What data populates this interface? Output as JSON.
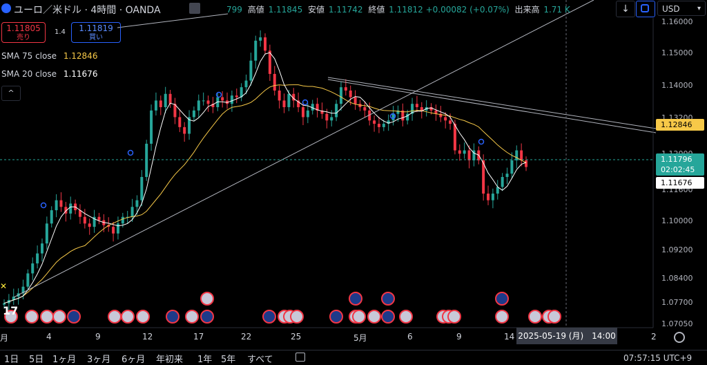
{
  "header": {
    "symbol_title": "ユーロ／米ドル · 4時間 · OANDA",
    "ohlc_open_partial": "799",
    "high_label": "高値",
    "high_value": "1.11845",
    "low_label": "安値",
    "low_value": "1.11742",
    "close_label": "終値",
    "close_value": "1.11812",
    "change": "+0.00082 (+0.07%)",
    "volume_label": "出来高",
    "volume_value": "1.71 K",
    "down_arrow": "↓",
    "currency": "USD"
  },
  "trade": {
    "sell_price": "1.11805",
    "sell_label": "売り",
    "spread": "1.4",
    "buy_price": "1.11819",
    "buy_label": "買い"
  },
  "indicators": [
    {
      "label": "SMA 75 close",
      "value": "1.12846"
    },
    {
      "label": "SMA 20 close",
      "value": "1.11676"
    }
  ],
  "price_axis": {
    "labels": [
      "1.16000",
      "1.15000",
      "1.14000",
      "1.13200",
      "1.12000",
      "1.11600",
      "1.10000",
      "1.09200",
      "1.08400",
      "1.07700",
      "1.07050"
    ],
    "tag_sma75": "1.12846",
    "tag_last": "1.11796",
    "tag_countdown": "02:02:45",
    "tag_sma20": "1.11676"
  },
  "time_axis": {
    "labels": [
      "月",
      "4",
      "9",
      "12",
      "17",
      "22",
      "25",
      "5月",
      "6",
      "9",
      "14",
      "2"
    ],
    "crosshair": "2025-05-19 (月)　14:00"
  },
  "bottom_bar": {
    "ranges": [
      "1日",
      "5日",
      "1ヶ月",
      "3ヶ月",
      "6ヶ月",
      "年初来",
      "1年",
      "5年",
      "すべて"
    ],
    "clock": "07:57:15 UTC+9"
  },
  "colors": {
    "up": "#26a69a",
    "down": "#f23645",
    "sma75": "#f7c948",
    "sma20": "#ffffff",
    "accent": "#2962ff"
  },
  "chart_data": {
    "type": "candlestick",
    "ylim": [
      1.0705,
      1.162
    ],
    "close": [
      1.077,
      1.078,
      1.079,
      1.08,
      1.082,
      1.086,
      1.089,
      1.092,
      1.095,
      1.101,
      1.105,
      1.108,
      1.106,
      1.104,
      1.107,
      1.105,
      1.103,
      1.101,
      1.1,
      1.103,
      1.102,
      1.1005,
      1.1,
      1.098,
      1.101,
      1.103,
      1.103,
      1.106,
      1.108,
      1.115,
      1.125,
      1.135,
      1.138,
      1.136,
      1.14,
      1.137,
      1.133,
      1.13,
      1.128,
      1.133,
      1.135,
      1.138,
      1.138,
      1.137,
      1.136,
      1.139,
      1.138,
      1.137,
      1.1395,
      1.139,
      1.142,
      1.144,
      1.15,
      1.156,
      1.157,
      1.153,
      1.146,
      1.141,
      1.138,
      1.136,
      1.14,
      1.138,
      1.136,
      1.133,
      1.135,
      1.137,
      1.135,
      1.134,
      1.132,
      1.133,
      1.137,
      1.142,
      1.141,
      1.139,
      1.137,
      1.136,
      1.135,
      1.132,
      1.131,
      1.13,
      1.131,
      1.132,
      1.134,
      1.135,
      1.132,
      1.134,
      1.137,
      1.136,
      1.135,
      1.136,
      1.135,
      1.134,
      1.133,
      1.132,
      1.131,
      1.123,
      1.122,
      1.123,
      1.12,
      1.123,
      1.12,
      1.11,
      1.108,
      1.11,
      1.112,
      1.115,
      1.116,
      1.12,
      1.123,
      1.12,
      1.118
    ]
  }
}
